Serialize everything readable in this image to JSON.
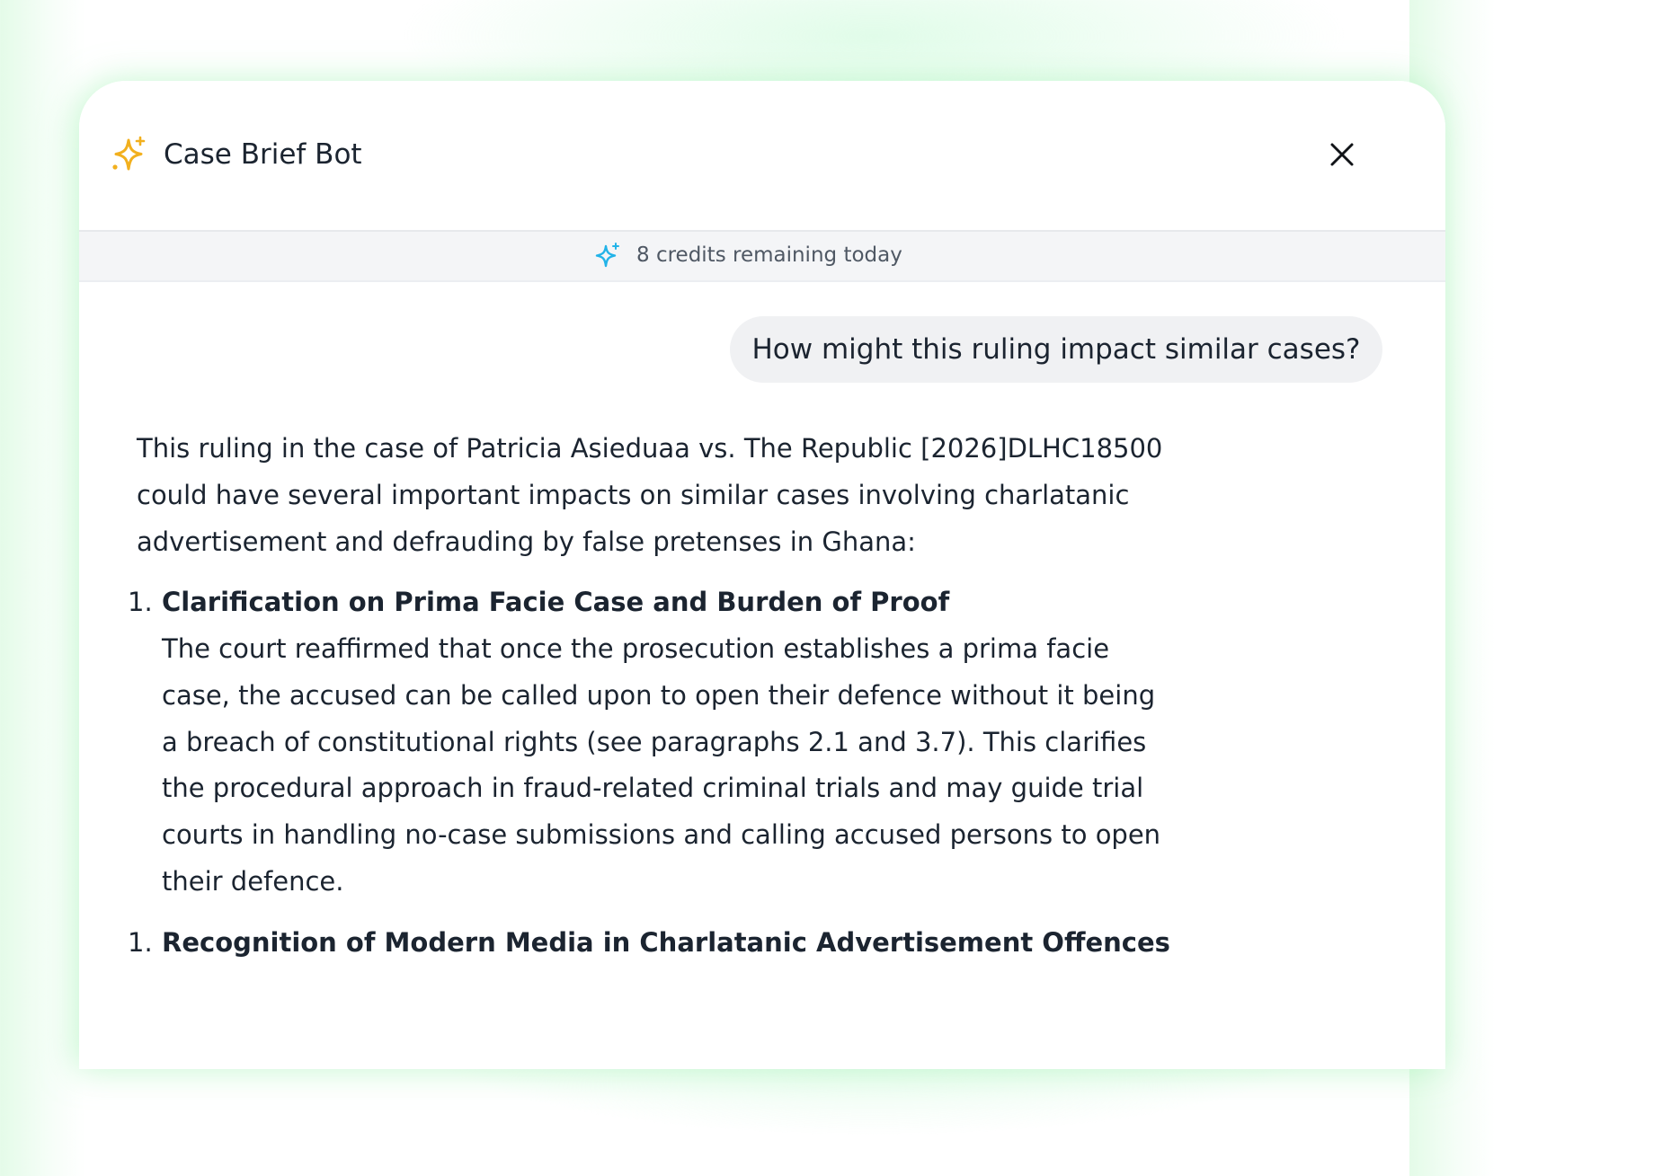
{
  "header": {
    "title": "Case Brief Bot",
    "brand_icon": "sparkle-icon",
    "close_icon": "close-icon",
    "brand_color": "#F2B01E"
  },
  "credits": {
    "text": "8 credits remaining today",
    "icon": "sparkle-icon",
    "icon_color": "#22B3E8"
  },
  "conversation": {
    "user_message": "How might this ruling impact similar cases?",
    "assistant": {
      "intro": "This ruling in the case of Patricia Asieduaa vs. The Republic [2026]DLHC18500 could have several important impacts on similar cases involving charlatanic advertisement and defrauding by false pretenses in Ghana:",
      "items": [
        {
          "number": "1.",
          "heading": "Clarification on Prima Facie Case and Burden of Proof",
          "body": "The court reaffirmed that once the prosecution establishes a prima facie case, the accused can be called upon to open their defence without it being a breach of constitutional rights (see paragraphs 2.1 and 3.7). This clarifies the procedural approach in fraud-related criminal trials and may guide trial courts in handling no-case submissions and calling accused persons to open their defence."
        },
        {
          "number": "1.",
          "heading": "Recognition of Modern Media in Charlatanic Advertisement Offences",
          "body": ""
        }
      ]
    }
  }
}
